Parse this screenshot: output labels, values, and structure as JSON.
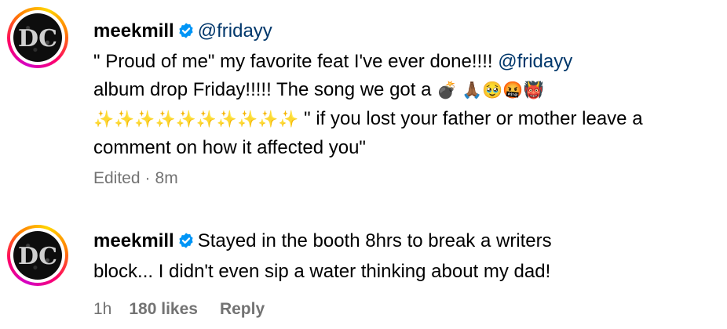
{
  "comments": [
    {
      "username": "meekmill",
      "mention": "@fridayy",
      "lines": [
        "\" Proud of me\" my favorite feat I've ever done!!!! ",
        "album drop Friday!!!!! The song we got a ",
        " \" if you lost your father or mother leave a",
        "comment on how it affected you\""
      ],
      "inline_mention": "@fridayy",
      "emojis_line2": "💣 🙏🏾🥹🤬👹",
      "sparkles": "✨✨✨✨✨✨✨✨✨✨",
      "edited": "Edited",
      "dot": "·",
      "time": "8m",
      "avatar_icon": "dc-logo-icon",
      "verified_icon": "verified-badge-icon"
    },
    {
      "username": "meekmill",
      "lines": [
        "Stayed in the booth 8hrs to break a writers",
        "block... I didn't even sip a water thinking about my dad!"
      ],
      "time": "1h",
      "likes": "180 likes",
      "reply": "Reply",
      "avatar_icon": "dc-logo-icon",
      "verified_icon": "verified-badge-icon"
    }
  ],
  "colors": {
    "verified_blue": "#0095f6",
    "mention_blue": "#00376b",
    "meta_gray": "#737373"
  }
}
